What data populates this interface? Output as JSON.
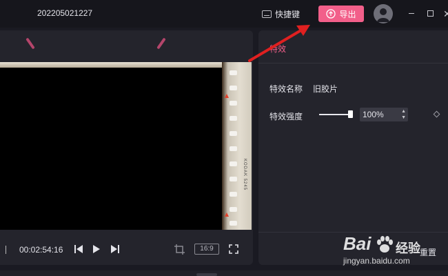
{
  "topbar": {
    "project_title": "202205021227",
    "shortcut_label": "快捷键",
    "export_label": "导出"
  },
  "player": {
    "timecode": "00:02:54:16",
    "aspect_ratio": "16:9",
    "film_print": "KODAK 5245"
  },
  "effects": {
    "tab_label": "特效",
    "name_label": "特效名称",
    "name_value": "旧胶片",
    "strength_label": "特效强度",
    "strength_value": "100%",
    "strength_fraction": 1.0,
    "reset_label": "重置"
  },
  "watermark": {
    "brand": "Bai",
    "brand_suffix": "经验",
    "url": "jingyan.baidu.com"
  },
  "colors": {
    "accent": "#f25f8a",
    "annotation_arrow": "#e02020"
  }
}
